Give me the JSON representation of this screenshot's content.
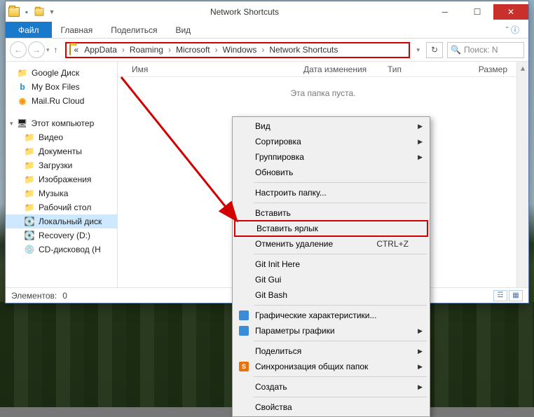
{
  "window": {
    "title": "Network Shortcuts"
  },
  "ribbon": {
    "file": "Файл",
    "tabs": [
      "Главная",
      "Поделиться",
      "Вид"
    ]
  },
  "address": {
    "prefix": "«",
    "crumbs": [
      "AppData",
      "Roaming",
      "Microsoft",
      "Windows",
      "Network Shortcuts"
    ]
  },
  "search": {
    "placeholder": "Поиск: N"
  },
  "tree": {
    "top": [
      {
        "label": "Google Диск",
        "icon": "📁",
        "color": "#f3c238"
      },
      {
        "label": "My Box Files",
        "icon": "b",
        "color": "#1b8ad6"
      },
      {
        "label": "Mail.Ru Cloud",
        "icon": "◉",
        "color": "#f29b00"
      }
    ],
    "computer_label": "Этот компьютер",
    "computer_icon": "🖥",
    "computer": [
      {
        "label": "Видео",
        "icon": "📁"
      },
      {
        "label": "Документы",
        "icon": "📁"
      },
      {
        "label": "Загрузки",
        "icon": "📁"
      },
      {
        "label": "Изображения",
        "icon": "📁"
      },
      {
        "label": "Музыка",
        "icon": "📁"
      },
      {
        "label": "Рабочий стол",
        "icon": "📁"
      },
      {
        "label": "Локальный диск",
        "icon": "💽",
        "selected": true
      },
      {
        "label": "Recovery (D:)",
        "icon": "💽"
      },
      {
        "label": "CD-дисковод (H",
        "icon": "💿"
      }
    ]
  },
  "columns": {
    "name": "Имя",
    "date": "Дата изменения",
    "type": "Тип",
    "size": "Размер"
  },
  "content": {
    "empty_message": "Эта папка пуста."
  },
  "status": {
    "elements_label": "Элементов:",
    "elements_count": "0"
  },
  "context_menu": {
    "items": [
      {
        "label": "Вид",
        "type": "sub"
      },
      {
        "label": "Сортировка",
        "type": "sub"
      },
      {
        "label": "Группировка",
        "type": "sub"
      },
      {
        "label": "Обновить",
        "type": "plain"
      },
      {
        "type": "sep"
      },
      {
        "label": "Настроить папку...",
        "type": "plain"
      },
      {
        "type": "sep"
      },
      {
        "label": "Вставить",
        "type": "plain"
      },
      {
        "label": "Вставить ярлык",
        "type": "plain",
        "highlighted": true
      },
      {
        "label": "Отменить удаление",
        "type": "plain",
        "shortcut": "CTRL+Z"
      },
      {
        "type": "sep"
      },
      {
        "label": "Git Init Here",
        "type": "plain"
      },
      {
        "label": "Git Gui",
        "type": "plain"
      },
      {
        "label": "Git Bash",
        "type": "plain"
      },
      {
        "type": "sep"
      },
      {
        "label": "Графические характеристики...",
        "type": "plain",
        "icon": "blue"
      },
      {
        "label": "Параметры графики",
        "type": "sub",
        "icon": "blue"
      },
      {
        "type": "sep"
      },
      {
        "label": "Поделиться",
        "type": "sub"
      },
      {
        "label": "Синхронизация общих папок",
        "type": "sub",
        "icon": "orange"
      },
      {
        "type": "sep"
      },
      {
        "label": "Создать",
        "type": "sub"
      },
      {
        "type": "sep"
      },
      {
        "label": "Свойства",
        "type": "plain"
      }
    ]
  }
}
